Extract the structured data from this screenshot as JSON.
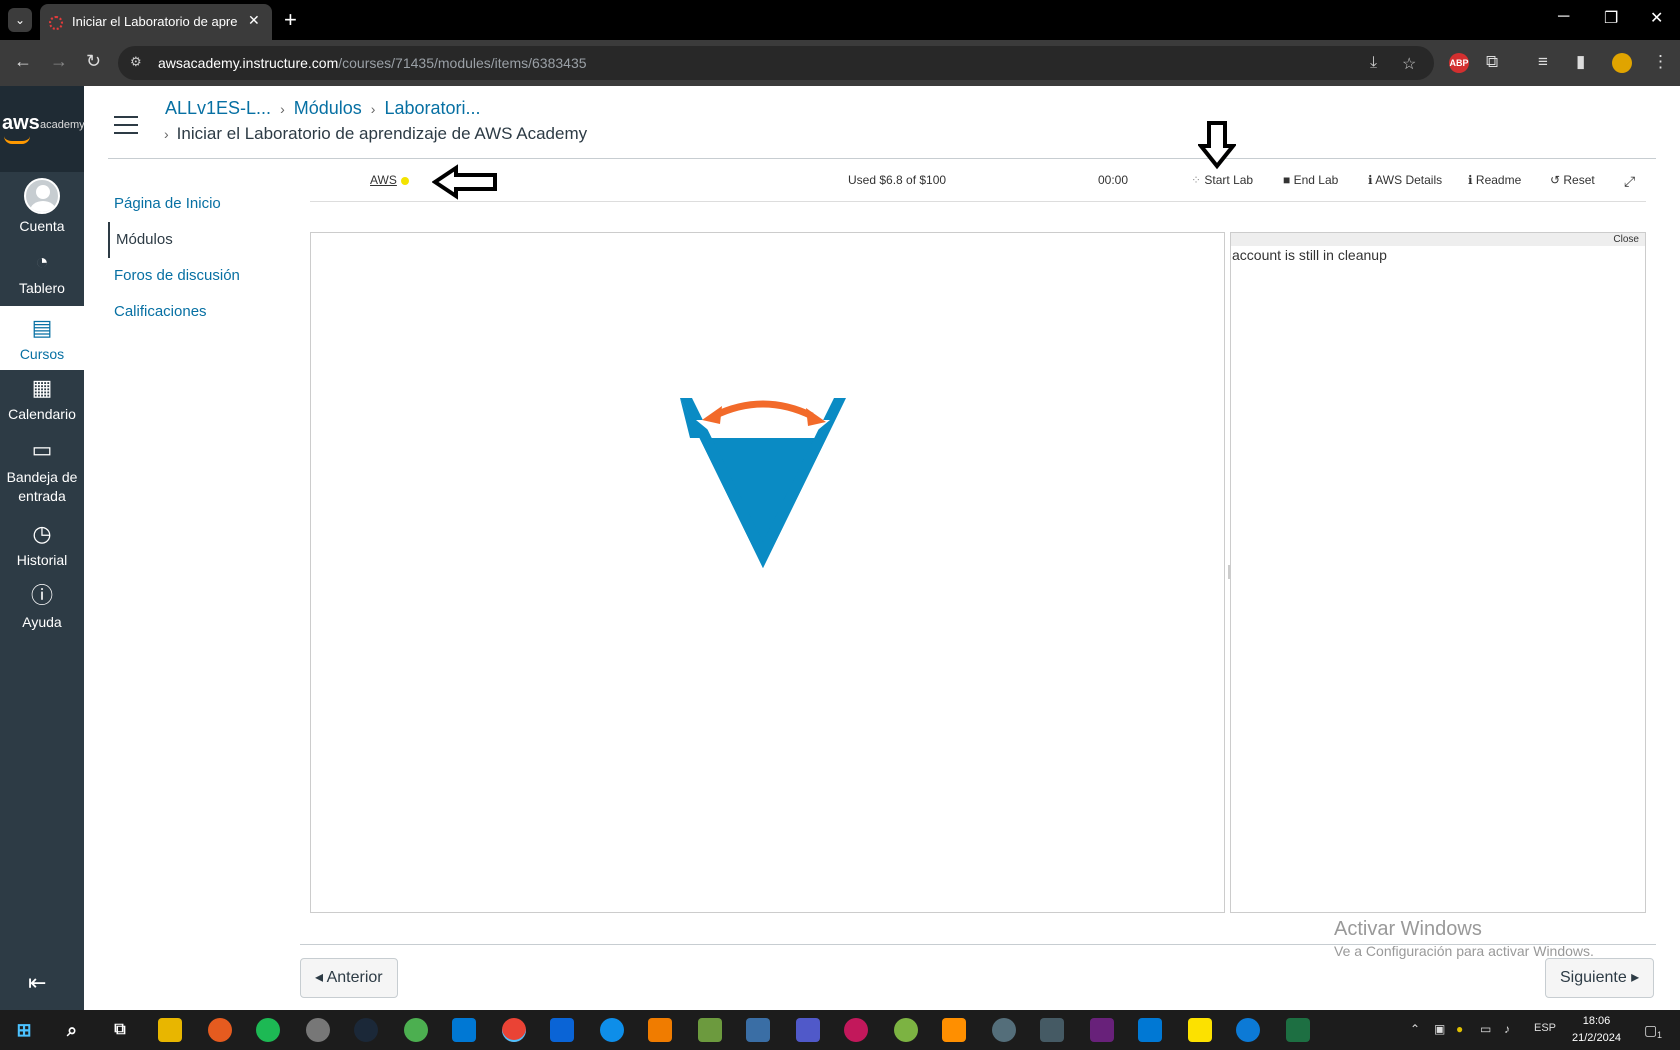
{
  "browser": {
    "tab_title": "Iniciar el Laboratorio de aprend",
    "new_tab": "+",
    "url_host": "awsacademy.instructure.com",
    "url_path": "/courses/71435/modules/items/6383435",
    "ext_abp": "ABP",
    "win_min": "─",
    "win_restore": "❐",
    "win_close": "✕"
  },
  "global_nav": {
    "logo_aws": "aws",
    "logo_academy": "academy",
    "items": [
      {
        "label": "Cuenta",
        "icon": "account-avatar"
      },
      {
        "label": "Tablero",
        "icon": "dashboard-gauge"
      },
      {
        "label": "Cursos",
        "icon": "courses-book"
      },
      {
        "label": "Calendario",
        "icon": "calendar"
      },
      {
        "label": "Bandeja de entrada",
        "icon": "inbox"
      },
      {
        "label": "Historial",
        "icon": "clock"
      },
      {
        "label": "Ayuda",
        "icon": "help"
      }
    ]
  },
  "breadcrumbs": {
    "items": [
      "ALLv1ES-L...",
      "Módulos",
      "Laboratori..."
    ],
    "current": "Iniciar el Laboratorio de aprendizaje de AWS Academy"
  },
  "course_nav": {
    "items": [
      "Página de Inicio",
      "Módulos",
      "Foros de discusión",
      "Calificaciones"
    ],
    "active": "Módulos"
  },
  "lab_toolbar": {
    "aws_label": "AWS",
    "aws_status_color": "#f3e300",
    "budget": "Used $6.8 of $100",
    "timer": "00:00",
    "start_lab": "Start Lab",
    "end_lab": "End Lab",
    "aws_details": "AWS Details",
    "readme": "Readme",
    "reset": "Reset"
  },
  "side_panel": {
    "close_label": "Close",
    "message": "account is still in cleanup"
  },
  "pager": {
    "previous": "◂ Anterior",
    "next": "Siguiente ▸"
  },
  "watermark": {
    "line1": "Activar Windows",
    "line2": "Ve a Configuración para activar Windows."
  },
  "taskbar": {
    "lang": "ESP",
    "time": "18:06",
    "date": "21/2/2024",
    "notifications": "1"
  },
  "colors": {
    "nav_bg": "#2d3b45",
    "link": "#0770a3",
    "logo_blue": "#0a8bc4",
    "logo_orange": "#f26a2a"
  }
}
